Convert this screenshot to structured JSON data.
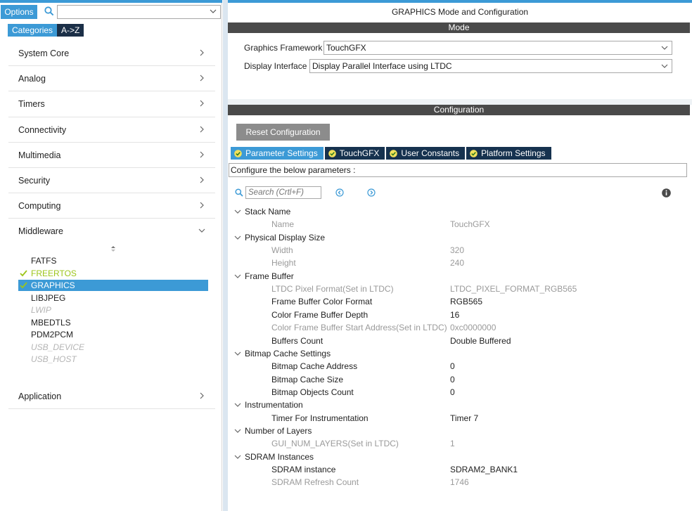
{
  "left": {
    "options_label": "Options",
    "search": {
      "value": "",
      "placeholder": ""
    },
    "tabs": [
      {
        "label": "Categories",
        "active": true
      },
      {
        "label": "A->Z",
        "active": false
      }
    ],
    "categories": [
      {
        "label": "System Core"
      },
      {
        "label": "Analog"
      },
      {
        "label": "Timers"
      },
      {
        "label": "Connectivity"
      },
      {
        "label": "Multimedia"
      },
      {
        "label": "Security"
      },
      {
        "label": "Computing"
      },
      {
        "label": "Middleware",
        "expanded": true
      }
    ],
    "middleware_items": [
      {
        "label": "FATFS",
        "state": "normal"
      },
      {
        "label": "FREERTOS",
        "state": "enabled-ok"
      },
      {
        "label": "GRAPHICS",
        "state": "selected"
      },
      {
        "label": "LIBJPEG",
        "state": "normal"
      },
      {
        "label": "LWIP",
        "state": "disabled"
      },
      {
        "label": "MBEDTLS",
        "state": "normal"
      },
      {
        "label": "PDM2PCM",
        "state": "normal"
      },
      {
        "label": "USB_DEVICE",
        "state": "disabled"
      },
      {
        "label": "USB_HOST",
        "state": "disabled"
      }
    ],
    "application_label": "Application"
  },
  "right": {
    "title": "GRAPHICS Mode and Configuration",
    "mode_bar": "Mode",
    "mode_fields": [
      {
        "label": "Graphics Framework",
        "value": "TouchGFX"
      },
      {
        "label": "Display Interface",
        "value": "Display Parallel Interface using LTDC"
      }
    ],
    "config_bar": "Configuration",
    "reset_button": "Reset Configuration",
    "config_tabs": [
      {
        "label": "Parameter Settings",
        "active": true
      },
      {
        "label": "TouchGFX",
        "active": false
      },
      {
        "label": "User Constants",
        "active": false
      },
      {
        "label": "Platform Settings",
        "active": false
      }
    ],
    "config_hint": "Configure the below parameters :",
    "param_search_placeholder": "Search (Crtl+F)",
    "groups": [
      {
        "name": "Stack Name",
        "params": [
          {
            "name": "Name",
            "value": "TouchGFX",
            "readonly": true
          }
        ]
      },
      {
        "name": "Physical Display Size",
        "params": [
          {
            "name": "Width",
            "value": "320",
            "readonly": true
          },
          {
            "name": "Height",
            "value": "240",
            "readonly": true
          }
        ]
      },
      {
        "name": "Frame Buffer",
        "params": [
          {
            "name": "LTDC Pixel Format(Set in LTDC)",
            "value": "LTDC_PIXEL_FORMAT_RGB565",
            "readonly": true
          },
          {
            "name": "Frame Buffer Color Format",
            "value": "RGB565",
            "readonly": false
          },
          {
            "name": "Color Frame Buffer Depth",
            "value": "16",
            "readonly": false
          },
          {
            "name": "Color Frame Buffer Start Address(Set in LTDC)",
            "value": "0xc0000000",
            "readonly": true
          },
          {
            "name": "Buffers Count",
            "value": "Double Buffered",
            "readonly": false
          }
        ]
      },
      {
        "name": "Bitmap Cache Settings",
        "params": [
          {
            "name": "Bitmap Cache Address",
            "value": "0",
            "readonly": false
          },
          {
            "name": "Bitmap Cache Size",
            "value": "0",
            "readonly": false
          },
          {
            "name": "Bitmap Objects Count",
            "value": "0",
            "readonly": false
          }
        ]
      },
      {
        "name": "Instrumentation",
        "params": [
          {
            "name": "Timer For Instrumentation",
            "value": "Timer 7",
            "readonly": false
          }
        ]
      },
      {
        "name": "Number of Layers",
        "params": [
          {
            "name": "GUI_NUM_LAYERS(Set in LTDC)",
            "value": "1",
            "readonly": true
          }
        ]
      },
      {
        "name": "SDRAM Instances",
        "params": [
          {
            "name": "SDRAM instance",
            "value": "SDRAM2_BANK1",
            "readonly": false
          },
          {
            "name": "SDRAM Refresh Count",
            "value": "1746",
            "readonly": true
          }
        ]
      }
    ]
  },
  "colors": {
    "accent": "#3c9ad6",
    "dark_tab": "#16324f",
    "bar": "#4a4a4a",
    "ok_green": "#9cc51a",
    "readonly_text": "#9a9a9a"
  },
  "icons": {
    "search": "search-icon",
    "chevron_right": "chevron-right-icon",
    "chevron_down": "chevron-down-icon",
    "check": "check-icon",
    "info": "info-icon",
    "prev": "prev-arrow-icon",
    "next": "next-arrow-icon"
  }
}
